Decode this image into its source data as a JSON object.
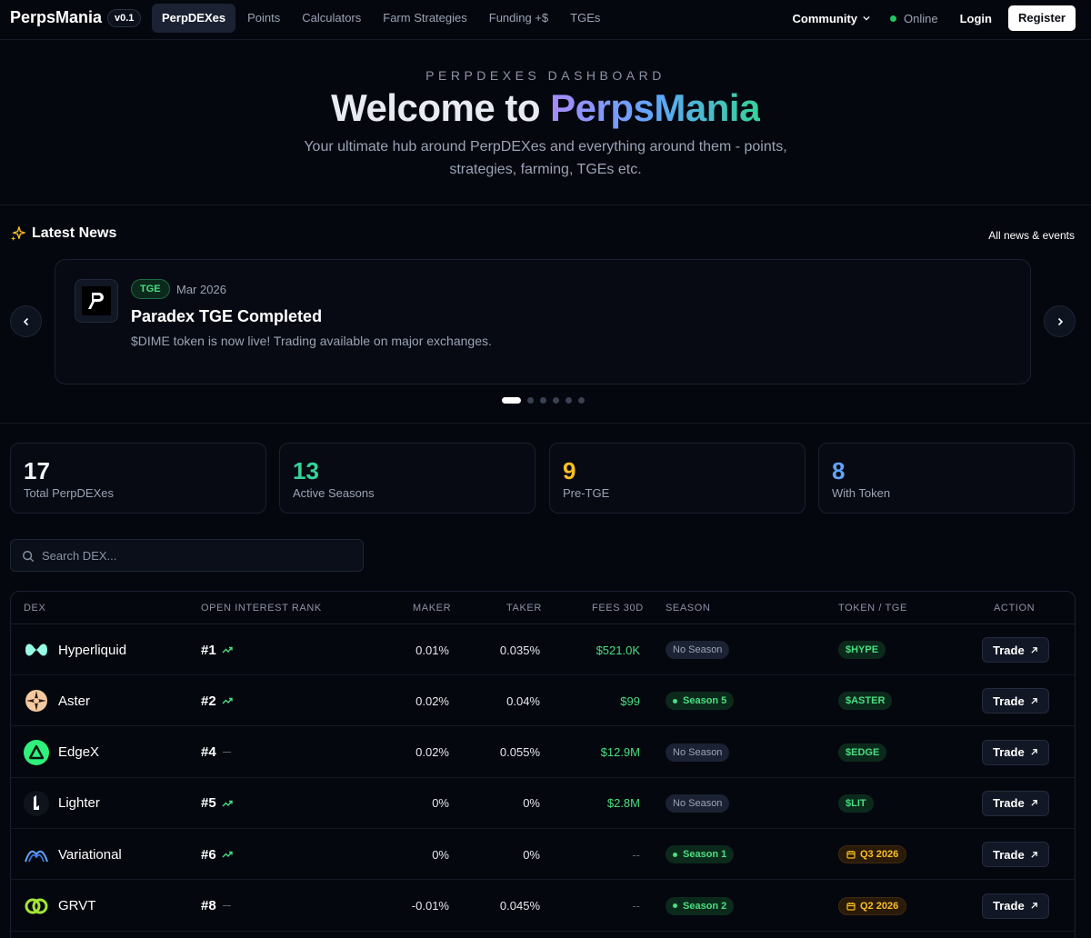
{
  "nav": {
    "brand": "PerpsMania",
    "version": "v0.1",
    "links": [
      {
        "label": "PerpDEXes",
        "active": true
      },
      {
        "label": "Points",
        "active": false
      },
      {
        "label": "Calculators",
        "active": false
      },
      {
        "label": "Farm Strategies",
        "active": false
      },
      {
        "label": "Funding +$",
        "active": false
      },
      {
        "label": "TGEs",
        "active": false
      }
    ],
    "community": "Community",
    "status": "Online",
    "login": "Login",
    "register": "Register"
  },
  "hero": {
    "eyebrow": "PERPDEXES DASHBOARD",
    "title_prefix": "Welcome to ",
    "title_highlight": "PerpsMania",
    "subtitle": "Your ultimate hub around PerpDEXes and everything around them - points, strategies, farming, TGEs etc."
  },
  "news": {
    "heading": "Latest News",
    "all_link": "All news & events",
    "item": {
      "tag": "TGE",
      "date": "Mar 2026",
      "headline": "Paradex TGE Completed",
      "body": "$DIME token is now live! Trading available on major exchanges."
    },
    "pagination": {
      "total": 6,
      "active": 0
    }
  },
  "stats": [
    {
      "value": "17",
      "label": "Total PerpDEXes",
      "color": "#f3f4f6"
    },
    {
      "value": "13",
      "label": "Active Seasons",
      "color": "#34d399"
    },
    {
      "value": "9",
      "label": "Pre-TGE",
      "color": "#fbbf24"
    },
    {
      "value": "8",
      "label": "With Token",
      "color": "#60a5fa"
    }
  ],
  "search": {
    "placeholder": "Search DEX..."
  },
  "table": {
    "headers": {
      "dex": "DEX",
      "oi_rank": "OPEN INTEREST RANK",
      "maker": "MAKER",
      "taker": "TAKER",
      "fees": "FEES 30D",
      "season": "SEASON",
      "token": "TOKEN / TGE",
      "action": "ACTION"
    },
    "trade_label": "Trade",
    "rows": [
      {
        "name": "Hyperliquid",
        "rank": "#1",
        "trend": "up",
        "maker": "0.01%",
        "taker": "0.035%",
        "fees": "$521.0K",
        "season": "No Season",
        "season_active": false,
        "token": "$HYPE",
        "token_type": "token"
      },
      {
        "name": "Aster",
        "rank": "#2",
        "trend": "up",
        "maker": "0.02%",
        "taker": "0.04%",
        "fees": "$99",
        "season": "Season 5",
        "season_active": true,
        "token": "$ASTER",
        "token_type": "token"
      },
      {
        "name": "EdgeX",
        "rank": "#4",
        "trend": "flat",
        "maker": "0.02%",
        "taker": "0.055%",
        "fees": "$12.9M",
        "season": "No Season",
        "season_active": false,
        "token": "$EDGE",
        "token_type": "token"
      },
      {
        "name": "Lighter",
        "rank": "#5",
        "trend": "up",
        "maker": "0%",
        "taker": "0%",
        "fees": "$2.8M",
        "season": "No Season",
        "season_active": false,
        "token": "$LIT",
        "token_type": "token"
      },
      {
        "name": "Variational",
        "rank": "#6",
        "trend": "up",
        "maker": "0%",
        "taker": "0%",
        "fees": "--",
        "season": "Season 1",
        "season_active": true,
        "token": "Q3 2026",
        "token_type": "tge"
      },
      {
        "name": "GRVT",
        "rank": "#8",
        "trend": "flat",
        "maker": "-0.01%",
        "taker": "0.045%",
        "fees": "--",
        "season": "Season 2",
        "season_active": true,
        "token": "Q2 2026",
        "token_type": "tge"
      }
    ]
  }
}
